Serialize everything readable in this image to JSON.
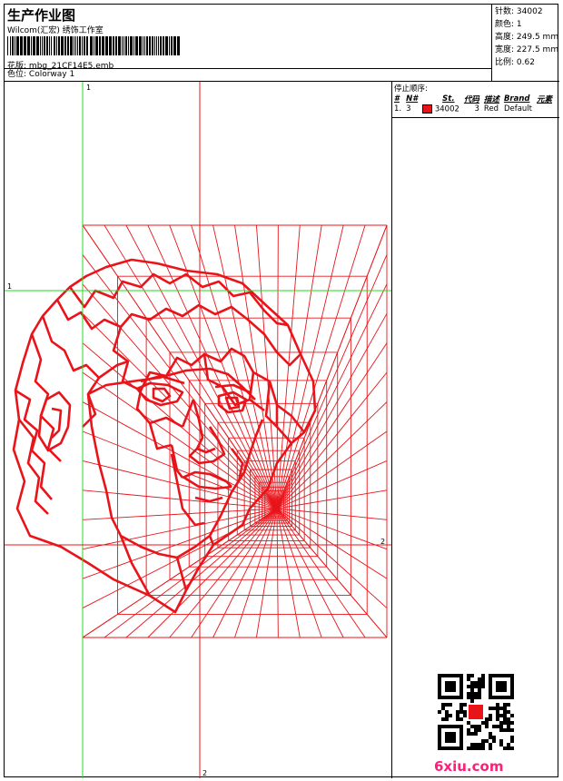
{
  "header": {
    "title": "生产作业图",
    "studio": "Wilcom(汇宏) 绣饰工作室",
    "design_label": "花版:",
    "design_value": "mbg_21CF14E5.emb",
    "colorway_label": "色位:",
    "colorway_value": "Colorway 1"
  },
  "stats": [
    {
      "label": "针数:",
      "value": "34002"
    },
    {
      "label": "颜色:",
      "value": "1"
    },
    {
      "label": "高度:",
      "value": "249.5 mm"
    },
    {
      "label": "宽度:",
      "value": "227.5 mm"
    },
    {
      "label": "比例:",
      "value": "0.62"
    }
  ],
  "stop_sequence": {
    "title": "停止顺序:",
    "columns": [
      "#",
      "N#",
      "St.",
      "代码",
      "描述",
      "Brand",
      "元素"
    ],
    "rows": [
      {
        "num": "1.",
        "n": "3",
        "color": "#e8141a",
        "stitches": "34002",
        "code": "3",
        "desc": "Red",
        "brand": "Default",
        "element": ""
      }
    ]
  },
  "guides": {
    "v1_label": "1",
    "h1_label": "1",
    "h2_label": "2",
    "v2_label": "2",
    "guide_color": "#22dd22",
    "design_color": "#e8141a"
  },
  "watermark": "6xiu.com"
}
